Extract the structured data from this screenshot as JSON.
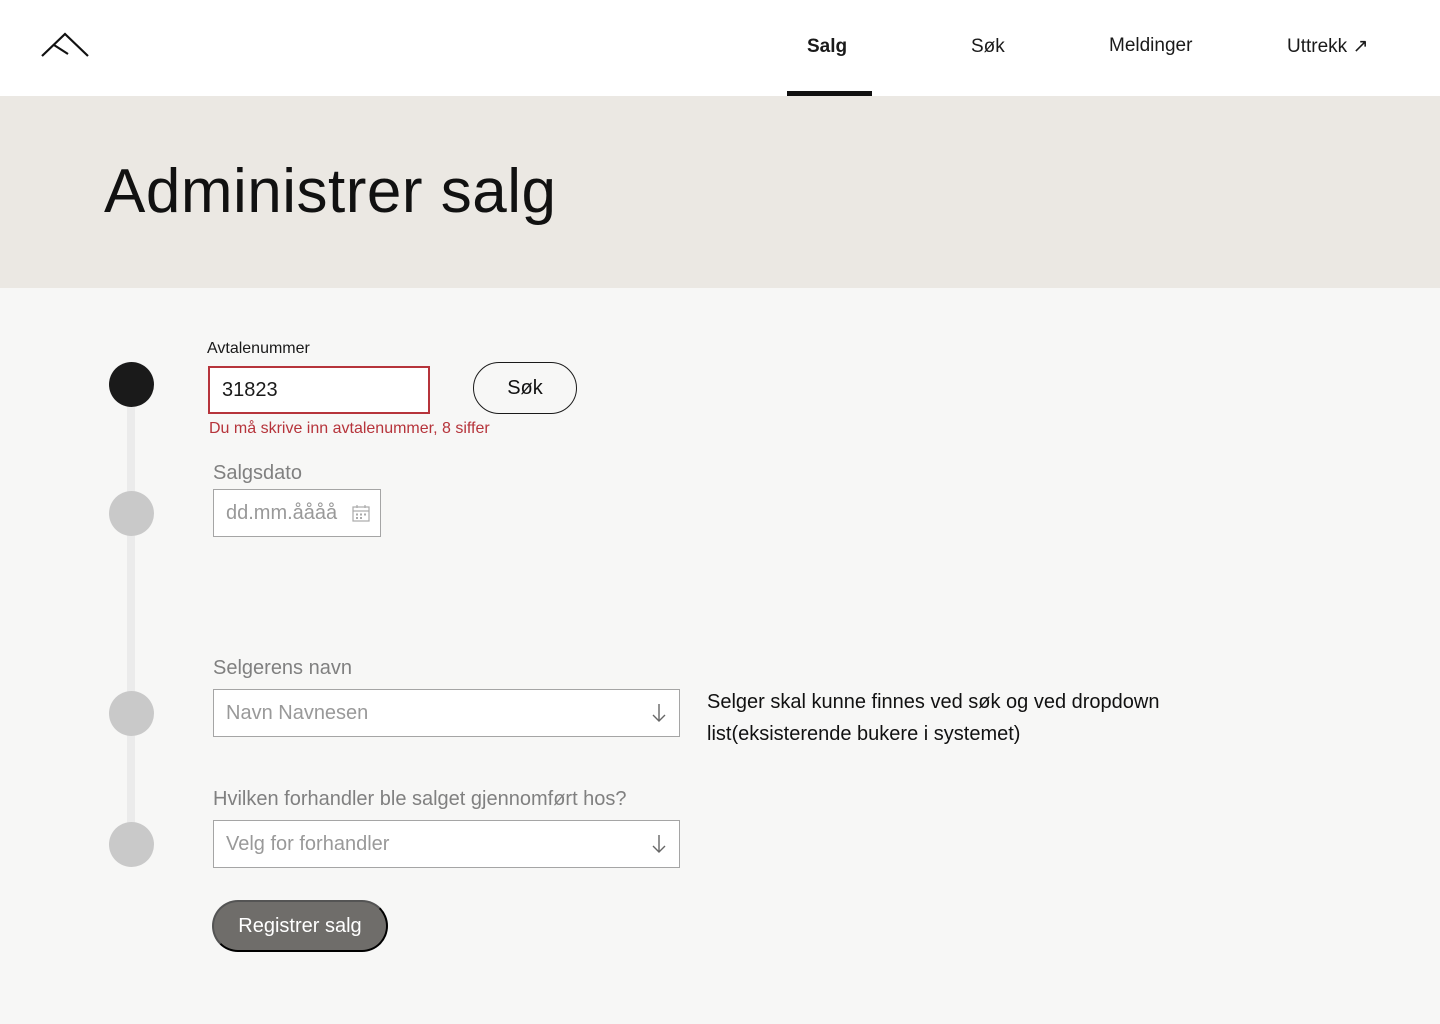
{
  "nav": {
    "items": [
      {
        "label": "Salg",
        "active": true
      },
      {
        "label": "Søk",
        "active": false
      },
      {
        "label": "Meldinger",
        "active": false
      },
      {
        "label": "Uttrekk ↗",
        "active": false
      }
    ]
  },
  "page": {
    "title": "Administrer salg"
  },
  "form": {
    "agreement": {
      "label": "Avtalenummer",
      "value": "31823",
      "error": "Du må skrive inn avtalenummer, 8 siffer",
      "search_button": "Søk"
    },
    "sale_date": {
      "label": "Salgsdato",
      "placeholder": "dd.mm.åååå"
    },
    "seller": {
      "label": "Selgerens navn",
      "placeholder": "Navn Navnesen",
      "note": "Selger skal kunne finnes ved søk og ved dropdown list(eksisterende bukere i systemet)"
    },
    "dealer": {
      "label": "Hvilken forhandler ble salget gjennomført hos?",
      "placeholder": "Velg for forhandler"
    },
    "submit_label": "Registrer salg"
  },
  "colors": {
    "hero_bg": "#ebe8e3",
    "error": "#b6343b",
    "step_active": "#1a1a1a",
    "step_inactive": "#c9c9c9",
    "button_disabled": "#6f6d6a"
  },
  "icons": {
    "logo": "roof-logo-icon",
    "external": "arrow-up-right-icon",
    "calendar": "calendar-icon",
    "dropdown": "arrow-down-icon"
  }
}
